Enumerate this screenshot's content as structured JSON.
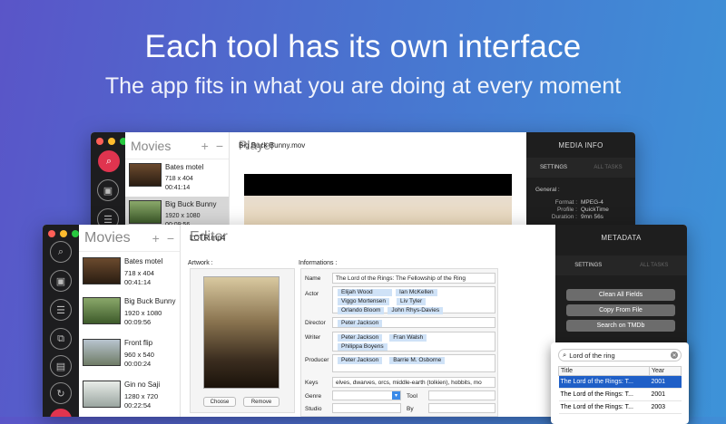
{
  "hero": {
    "title": "Each tool has its own interface",
    "subtitle": "The app fits in what you are doing at every moment"
  },
  "player_window": {
    "movies_title": "Movies",
    "add_label": "+",
    "remove_label": "−",
    "movies": [
      {
        "name": "Bates motel",
        "size": "718 x 404",
        "duration": "00:41:14"
      },
      {
        "name": "Big Buck Bunny",
        "size": "1920 x 1080",
        "duration": "00:09:56"
      }
    ],
    "player_title": "Player",
    "file_name": "Big Buck Bunny.mov",
    "media_info": {
      "title": "MEDIA INFO",
      "tab_settings": "SETTINGS",
      "tab_all_tasks": "ALL TASKS",
      "section": "General :",
      "rows": [
        {
          "k": "Format :",
          "v": "MPEG-4"
        },
        {
          "k": "Profile :",
          "v": "QuickTime"
        },
        {
          "k": "Duration :",
          "v": "9mn 56s"
        }
      ]
    }
  },
  "editor_window": {
    "movies_title": "Movies",
    "add_label": "+",
    "remove_label": "−",
    "movies": [
      {
        "name": "Bates motel",
        "size": "718 x 404",
        "duration": "00:41:14"
      },
      {
        "name": "Big Buck Bunny",
        "size": "1920 x 1080",
        "duration": "00:09:56"
      },
      {
        "name": "Front flip",
        "size": "960 x 540",
        "duration": "00:00:24"
      },
      {
        "name": "Gin no Saji",
        "size": "1280 x 720",
        "duration": "00:22:54"
      }
    ],
    "editor_title": "Editor",
    "file_name": "LOTR.mp4",
    "artwork_label": "Artwork :",
    "choose_label": "Choose",
    "remove_button_label": "Remove",
    "informations_label": "Informations :",
    "fields": {
      "name_label": "Name",
      "name_value": "The Lord of the Rings: The Fellowship of the Ring",
      "actor_label": "Actor",
      "actors": [
        "Elijah Wood",
        "Ian McKellen",
        "Viggo Mortensen",
        "Liv Tyler",
        "Orlando Bloom",
        "John Rhys-Davies"
      ],
      "director_label": "Director",
      "directors": [
        "Peter Jackson"
      ],
      "writer_label": "Writer",
      "writers": [
        "Peter Jackson",
        "Fran Walsh",
        "Philippa Boyens"
      ],
      "producer_label": "Producer",
      "producers": [
        "Peter Jackson",
        "Barrie M. Osborne"
      ],
      "keys_label": "Keys",
      "keys_value": "elves, dwarves, orcs, middle-earth (tolkien), hobbits, mo",
      "genre_label": "Genre",
      "tool_label": "Tool",
      "studio_label": "Studio",
      "by_label": "By"
    },
    "metadata": {
      "title": "METADATA",
      "tab_settings": "SETTINGS",
      "tab_all_tasks": "ALL TASKS",
      "clean_all": "Clean All Fields",
      "copy_from_file": "Copy From File",
      "search_tmdb": "Search on TMDb"
    }
  },
  "search_popup": {
    "query": "Lord of the ring",
    "col_title": "Title",
    "col_year": "Year",
    "results": [
      {
        "title": "The Lord of the Rings: T...",
        "year": "2001"
      },
      {
        "title": "The Lord of the Rings: T...",
        "year": "2001"
      },
      {
        "title": "The Lord of the Rings: T...",
        "year": "2003"
      }
    ]
  },
  "colors": {
    "accent_red": "#e0344f",
    "selection_blue": "#1f5fc7",
    "tag_blue": "#cfe2f7"
  }
}
